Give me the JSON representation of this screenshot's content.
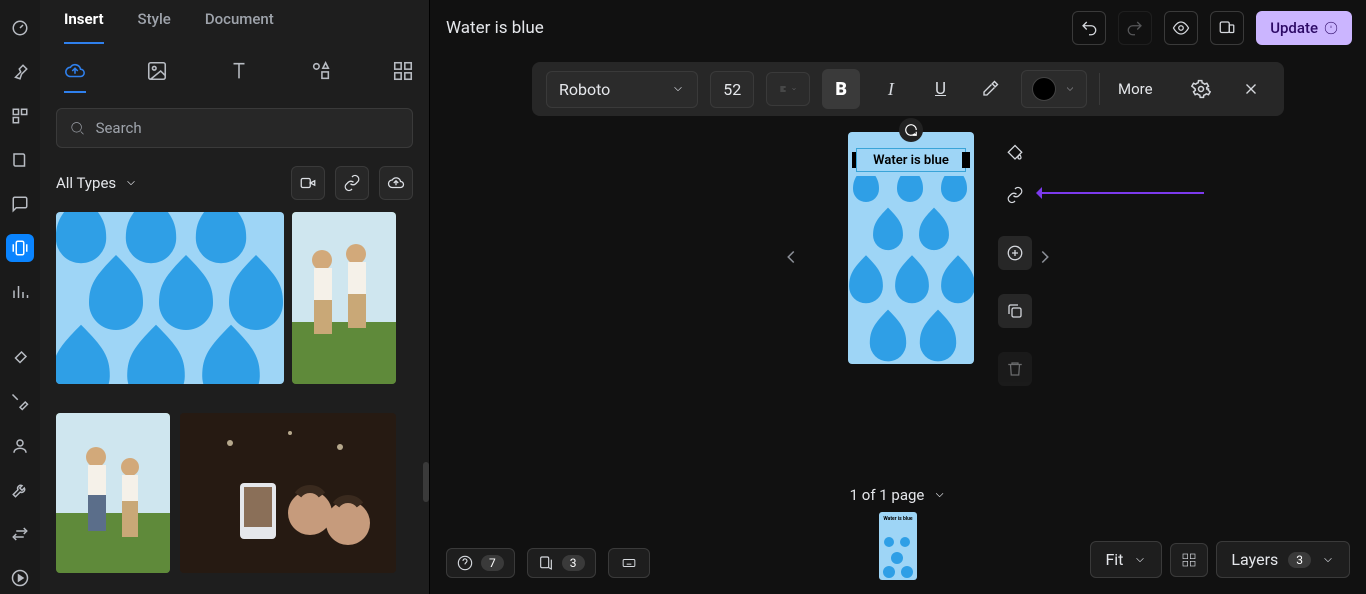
{
  "doc_title": "Water is blue",
  "tabs": {
    "insert": "Insert",
    "style": "Style",
    "document": "Document"
  },
  "search": {
    "placeholder": "Search"
  },
  "all_types_label": "All Types",
  "toolbar": {
    "font": "Roboto",
    "size": "52",
    "more": "More"
  },
  "update_label": "Update",
  "canvas_text": "Water is blue",
  "page_indicator": "1 of 1 page",
  "thumb_title": "Water is blue",
  "zoom_label": "Fit",
  "layers_label": "Layers",
  "layers_count": "3",
  "help_count": "7",
  "comment_count": "3"
}
